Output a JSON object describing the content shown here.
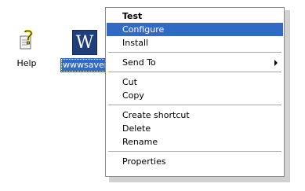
{
  "desktop": {
    "icons": [
      {
        "label": "Help",
        "icon": "help-icon"
      },
      {
        "label": "wwwsaver",
        "glyph": "W",
        "icon": "wwwsaver-icon"
      }
    ]
  },
  "context_menu": {
    "items": [
      {
        "label": "Test",
        "bold": true
      },
      {
        "label": "Configure",
        "selected": true
      },
      {
        "label": "Install"
      },
      {
        "label": "Send To",
        "submenu": true
      },
      {
        "label": "Cut"
      },
      {
        "label": "Copy"
      },
      {
        "label": "Create shortcut"
      },
      {
        "label": "Delete"
      },
      {
        "label": "Rename"
      },
      {
        "label": "Properties"
      }
    ]
  },
  "colors": {
    "selection": "#316ac5",
    "wwwsaver_tile": "#1f3f7a"
  }
}
